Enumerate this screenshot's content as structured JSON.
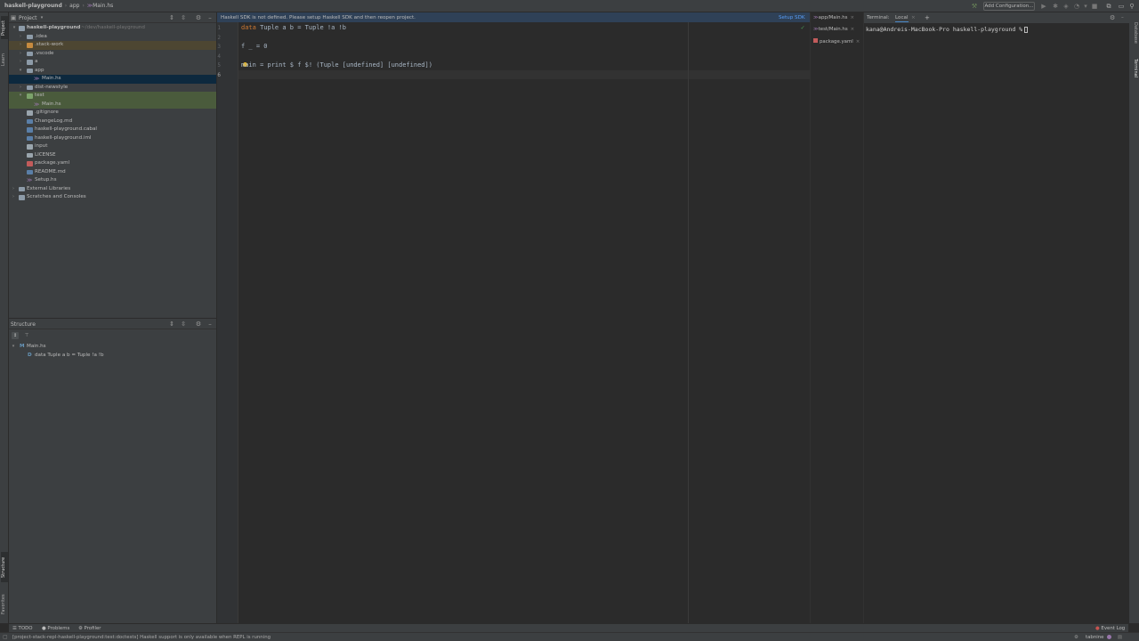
{
  "breadcrumb": {
    "project": "haskell-playground",
    "folder": "app",
    "file": "Main.hs"
  },
  "toolbar": {
    "add_configuration": "Add Configuration..."
  },
  "left_stripe": {
    "project": "Project",
    "learn": "Learn",
    "structure": "Structure",
    "favorites": "Favorites"
  },
  "right_stripe": {
    "database": "Database",
    "terminal": "Terminal"
  },
  "project_panel": {
    "title": "Project",
    "root": {
      "name": "haskell-playground",
      "path": "~/dev/haskell-playground"
    },
    "items": [
      {
        "name": ".idea"
      },
      {
        "name": ".stack-work"
      },
      {
        "name": ".vscode"
      },
      {
        "name": "a"
      },
      {
        "name": "app"
      },
      {
        "name": "Main.hs"
      },
      {
        "name": "dist-newstyle"
      },
      {
        "name": "test"
      },
      {
        "name": "Main.hs"
      },
      {
        "name": ".gitignore"
      },
      {
        "name": "ChangeLog.md"
      },
      {
        "name": "haskell-playground.cabal"
      },
      {
        "name": "haskell-playground.iml"
      },
      {
        "name": "input"
      },
      {
        "name": "LICENSE"
      },
      {
        "name": "package.yaml"
      },
      {
        "name": "README.md"
      },
      {
        "name": "Setup.hs"
      },
      {
        "name": "External Libraries"
      },
      {
        "name": "Scratches and Consoles"
      }
    ]
  },
  "structure_panel": {
    "title": "Structure",
    "file": "Main.hs",
    "entry": "data Tuple a b = Tuple !a !b"
  },
  "editor": {
    "banner_message": "Haskell SDK is not defined. Please setup Haskell SDK and then reopen project.",
    "banner_action": "Setup SDK",
    "line_numbers": [
      "1",
      "2",
      "3",
      "4",
      "5",
      "6"
    ],
    "lines": {
      "l1_kw": "data",
      "l1_rest": " Tuple a b = Tuple !a !b",
      "l3": "f _ = 0",
      "l5": "main = print $ f $! (Tuple [undefined] [undefined])"
    }
  },
  "split_tabs": [
    "app/Main.hs",
    "test/Main.hs",
    "package.yaml"
  ],
  "terminal": {
    "label": "Terminal:",
    "tab": "Local",
    "prompt": "kana@Andreis-MacBook-Pro haskell-playground %"
  },
  "bottom_tools": {
    "todo": "TODO",
    "problems": "Problems",
    "profiler": "Profiler",
    "event_log": "Event Log"
  },
  "status": {
    "message": "[project-stack-repl-haskell-playground:test:doctests] Haskell support is only available when REPL is running",
    "tabnine": "tabnine"
  },
  "colors": {
    "accent": "#589df6",
    "keyword": "#cc7832",
    "banner": "#2f4157"
  }
}
